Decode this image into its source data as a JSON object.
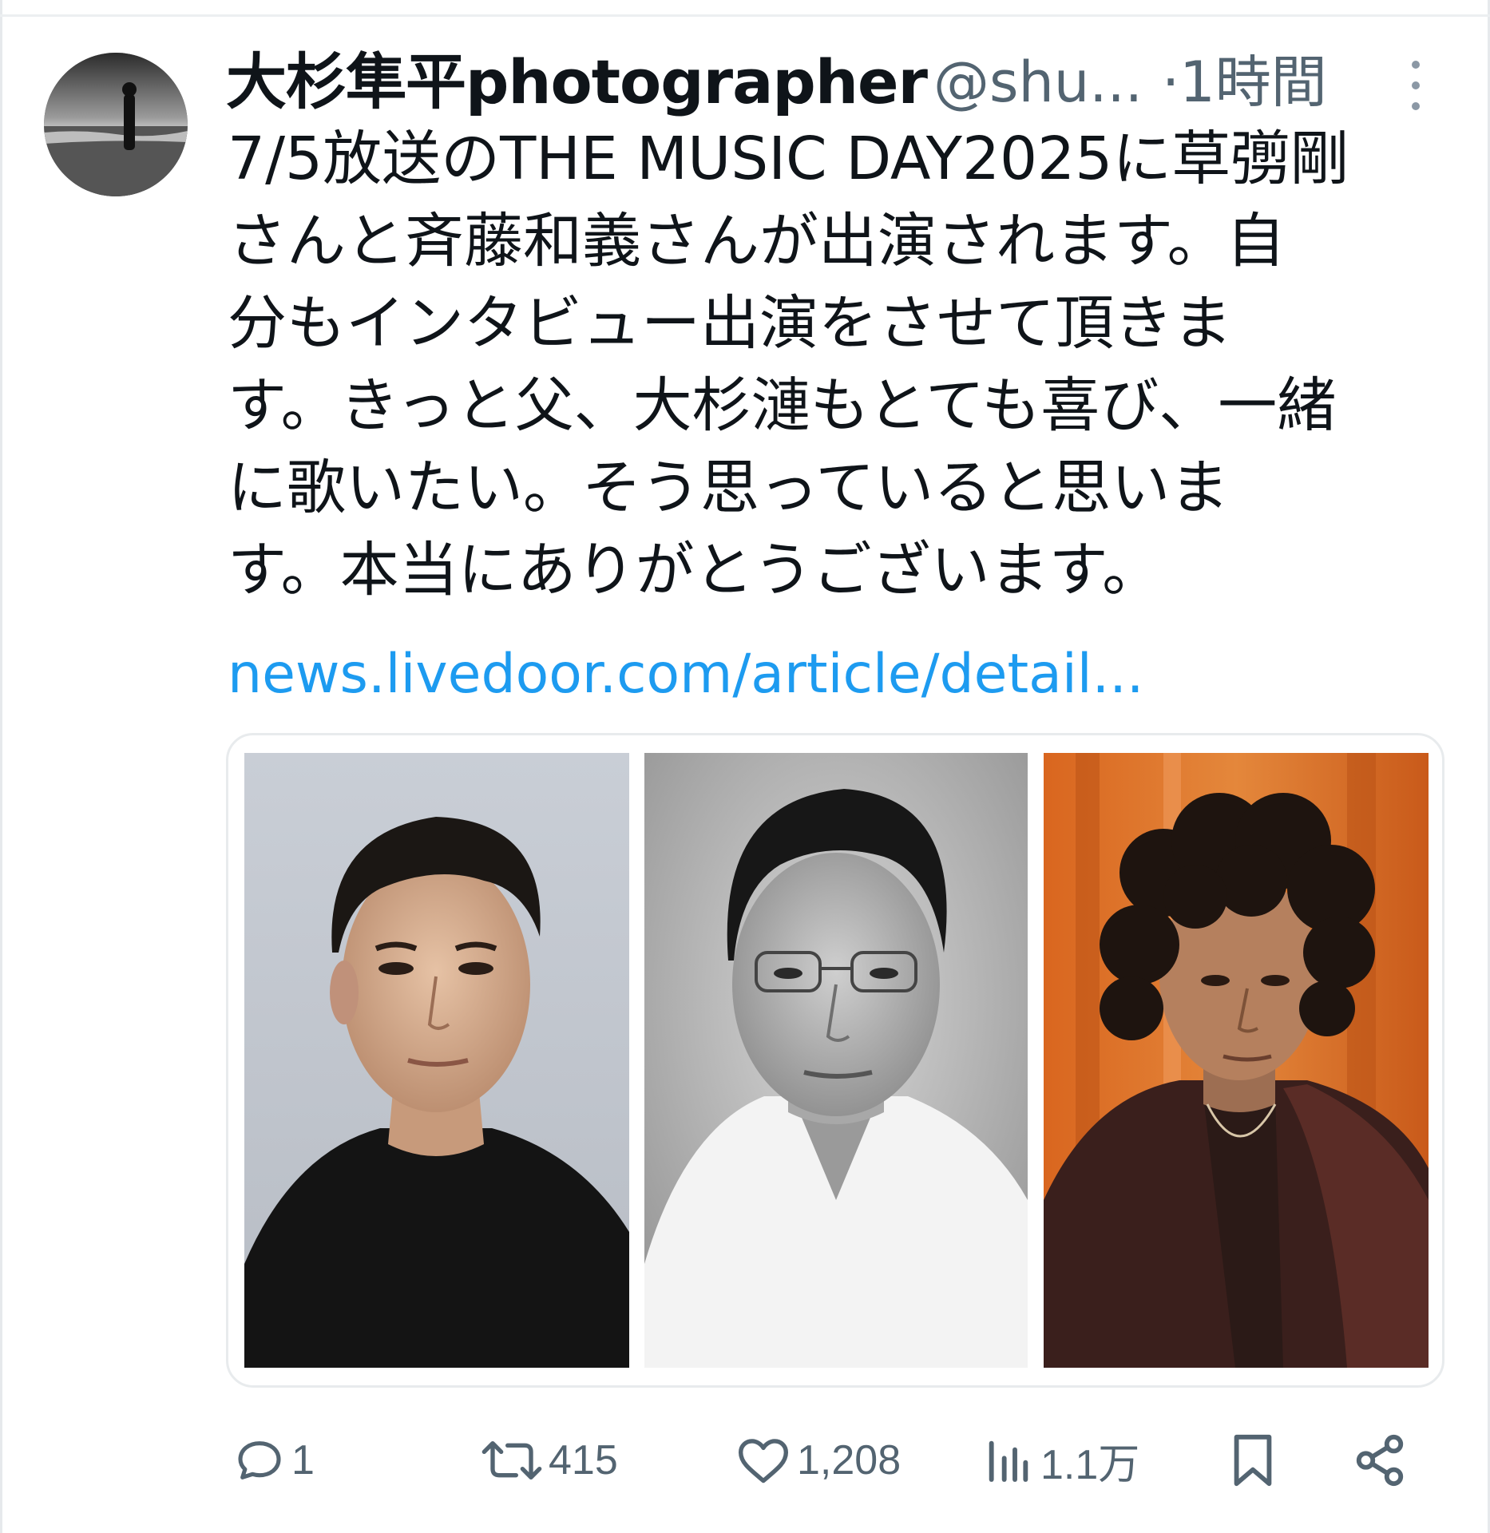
{
  "tweet": {
    "author": {
      "display_name": "大杉隼平photographer",
      "handle": "@shu...",
      "separator": "·",
      "time": "1時間"
    },
    "text_lines": [
      "7/5放送のTHE MUSIC DAY2025に草彅剛",
      "さんと斉藤和義さんが出演されます。自",
      "分もインタビュー出演をさせて頂きま",
      "す。きっと父、大杉漣もとても喜び、一緒",
      "に歌いたい。そう思っていると思いま",
      "す。本当にありがとうございます。"
    ],
    "link": "news.livedoor.com/article/detail...",
    "media_count": 3,
    "actions": {
      "reply": {
        "icon": "reply-icon",
        "count": "1"
      },
      "retweet": {
        "icon": "retweet-icon",
        "count": "415"
      },
      "like": {
        "icon": "heart-icon",
        "count": "1,208"
      },
      "views": {
        "icon": "views-chart-icon",
        "count": "1.1万"
      },
      "bookmark": {
        "icon": "bookmark-icon"
      },
      "share": {
        "icon": "share-icon"
      }
    }
  },
  "colors": {
    "text": "#0f1419",
    "secondary": "#536471",
    "link": "#1d9bf0",
    "border": "#e8ebed"
  }
}
